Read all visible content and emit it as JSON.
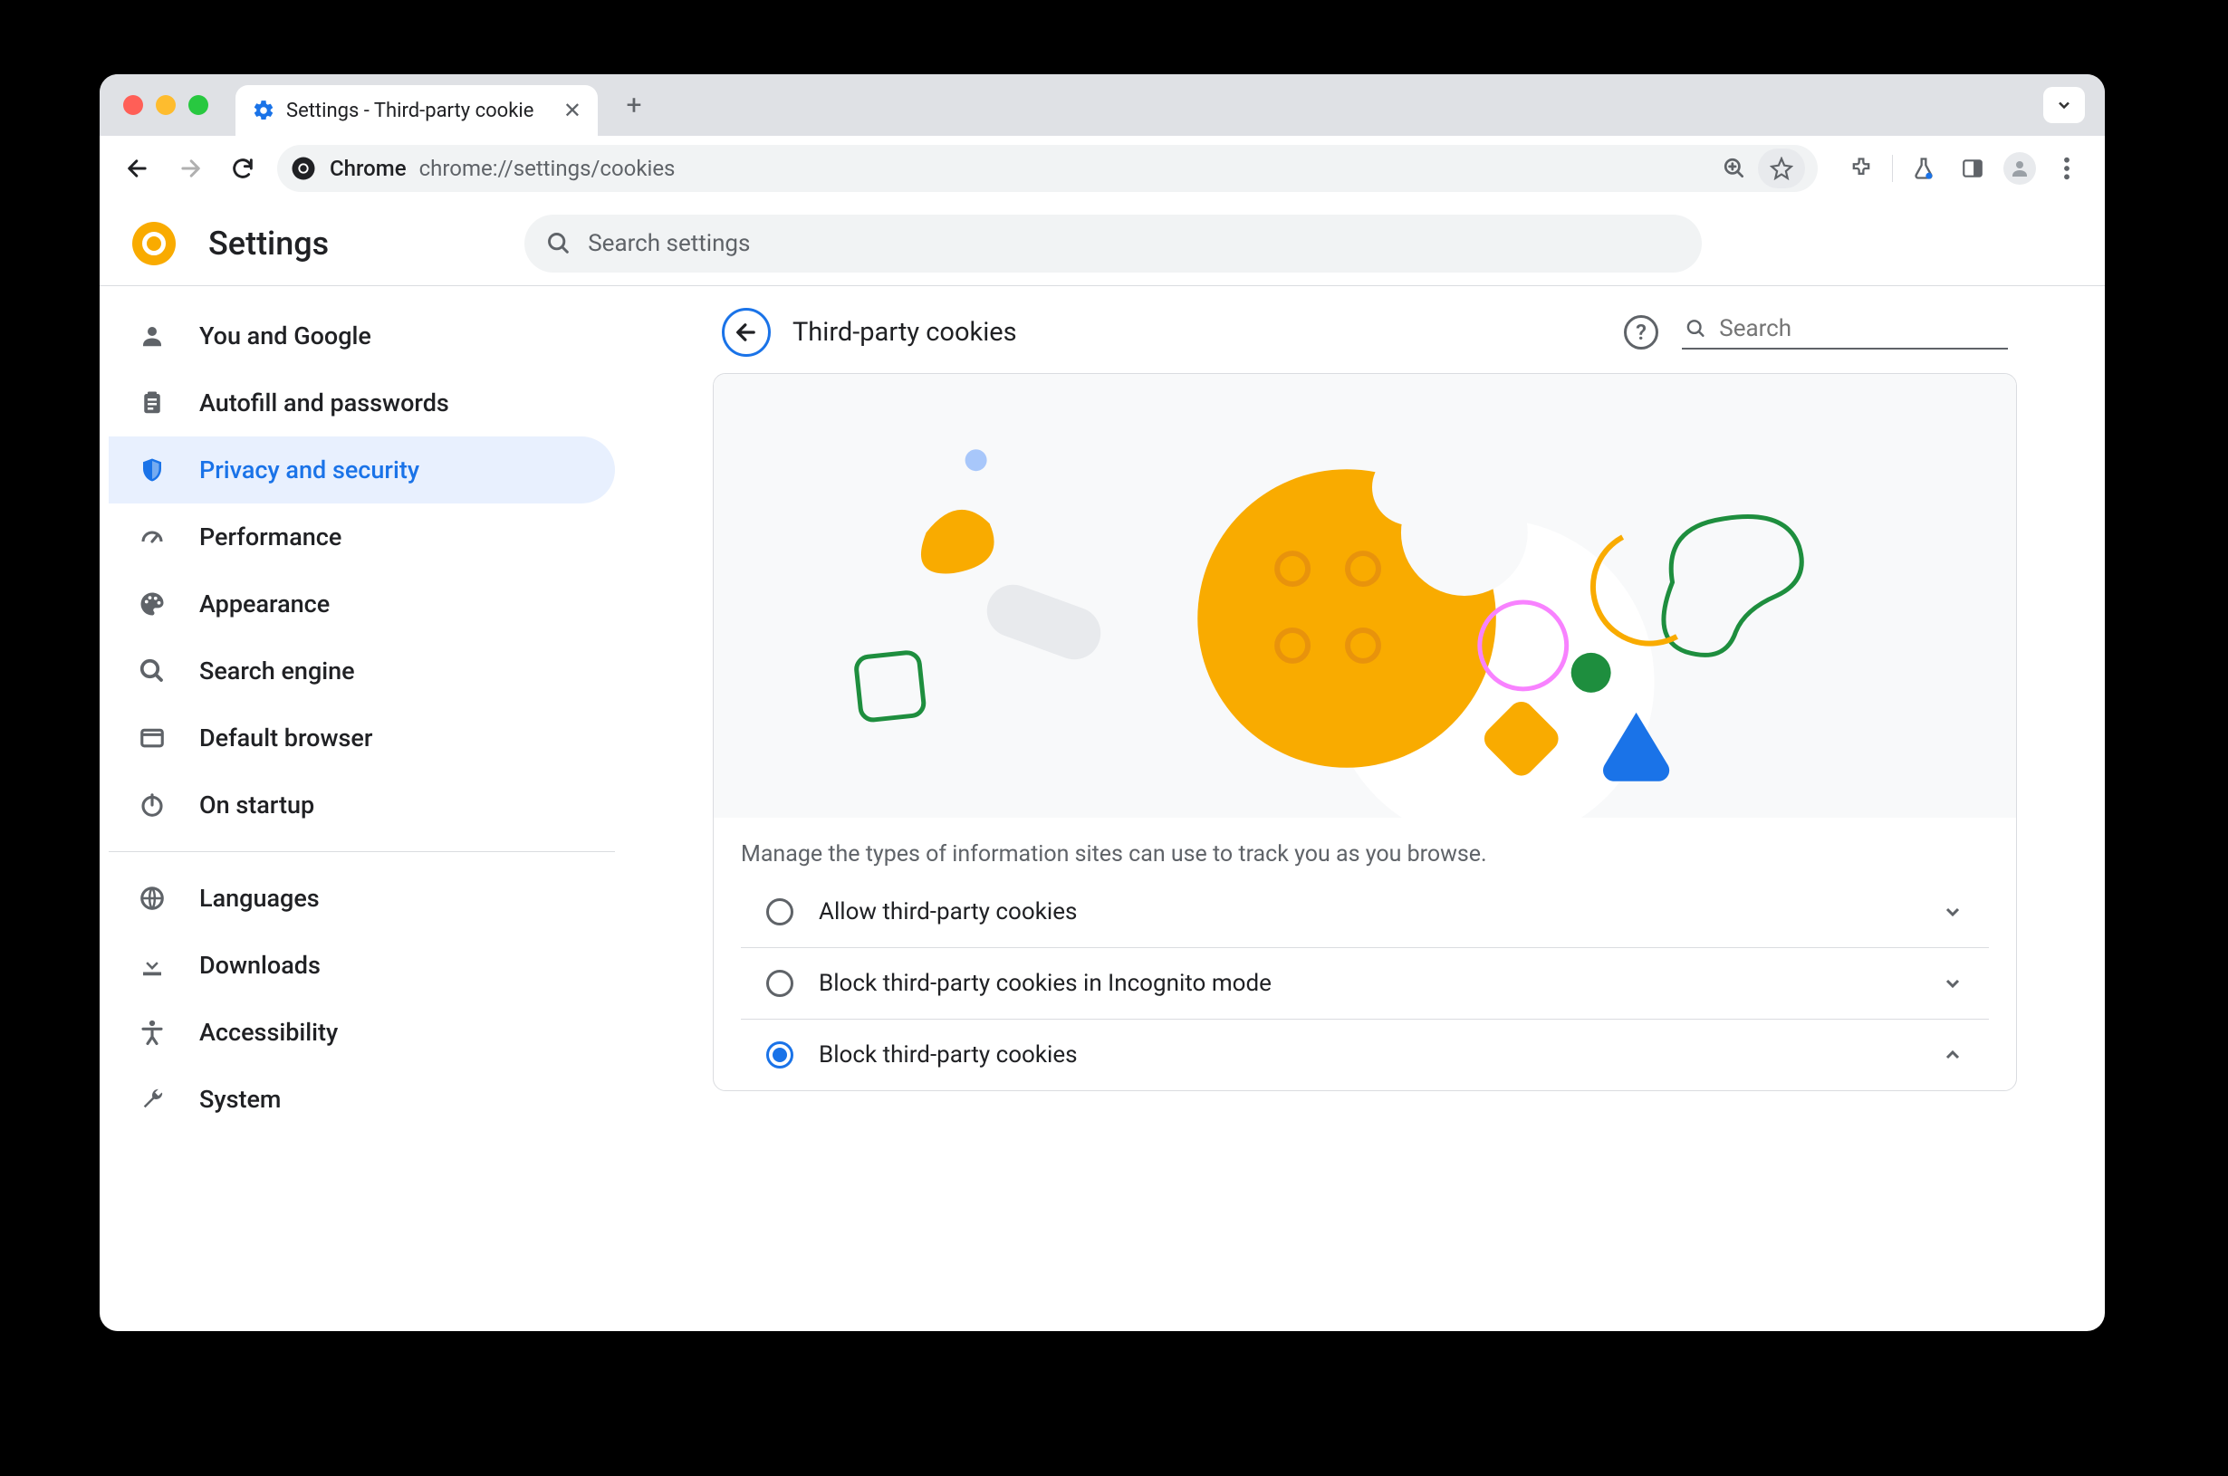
{
  "browser": {
    "tab_title": "Settings - Third-party cookie",
    "url_scheme_label": "Chrome",
    "url": "chrome://settings/cookies"
  },
  "header": {
    "app_title": "Settings",
    "search_placeholder": "Search settings"
  },
  "sidebar": {
    "items": [
      {
        "label": "You and Google",
        "icon": "person"
      },
      {
        "label": "Autofill and passwords",
        "icon": "clipboard"
      },
      {
        "label": "Privacy and security",
        "icon": "shield",
        "active": true
      },
      {
        "label": "Performance",
        "icon": "speedometer"
      },
      {
        "label": "Appearance",
        "icon": "palette"
      },
      {
        "label": "Search engine",
        "icon": "search"
      },
      {
        "label": "Default browser",
        "icon": "window"
      },
      {
        "label": "On startup",
        "icon": "power"
      }
    ],
    "items2": [
      {
        "label": "Languages",
        "icon": "globe"
      },
      {
        "label": "Downloads",
        "icon": "download"
      },
      {
        "label": "Accessibility",
        "icon": "accessibility"
      },
      {
        "label": "System",
        "icon": "wrench"
      }
    ]
  },
  "page": {
    "title": "Third-party cookies",
    "search_placeholder": "Search",
    "description": "Manage the types of information sites can use to track you as you browse.",
    "options": [
      {
        "label": "Allow third-party cookies",
        "selected": false,
        "expanded": false
      },
      {
        "label": "Block third-party cookies in Incognito mode",
        "selected": false,
        "expanded": false
      },
      {
        "label": "Block third-party cookies",
        "selected": true,
        "expanded": true
      }
    ]
  },
  "colors": {
    "accent": "#1a73e8",
    "yellow": "#f9ab00",
    "green": "#1e8e3e",
    "pink": "#f882ff"
  }
}
